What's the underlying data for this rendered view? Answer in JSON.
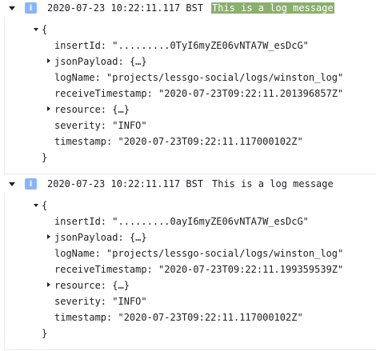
{
  "entries": [
    {
      "timestamp": "2020-07-23 10:22:11.117 BST",
      "message": "This is a log message",
      "severity_icon": "info-icon",
      "badge_letter": "i",
      "open_brace": "{",
      "close_brace": "}",
      "insertId_key": "insertId:",
      "insertId_val": "\".........0TyI6myZE06vNTA7W_esDcG\"",
      "jsonPayload_key": "jsonPayload:",
      "jsonPayload_val": "{…}",
      "logName_key": "logName:",
      "logName_val": "\"projects/lessgo-social/logs/winston_log\"",
      "receiveTimestamp_key": "receiveTimestamp:",
      "receiveTimestamp_val": "\"2020-07-23T09:22:11.201396857Z\"",
      "resource_key": "resource:",
      "resource_val": "{…}",
      "severity_key": "severity:",
      "severity_val": "\"INFO\"",
      "timestamp_key": "timestamp:",
      "timestamp_val": "\"2020-07-23T09:22:11.117000102Z\""
    },
    {
      "timestamp": "2020-07-23 10:22:11.117 BST",
      "message": "This is a log message",
      "severity_icon": "info-icon",
      "badge_letter": "i",
      "open_brace": "{",
      "close_brace": "}",
      "insertId_key": "insertId:",
      "insertId_val": "\".........0ayI6myZE06vNTA7W_esDcG\"",
      "jsonPayload_key": "jsonPayload:",
      "jsonPayload_val": "{…}",
      "logName_key": "logName:",
      "logName_val": "\"projects/lessgo-social/logs/winston_log\"",
      "receiveTimestamp_key": "receiveTimestamp:",
      "receiveTimestamp_val": "\"2020-07-23T09:22:11.199359539Z\"",
      "resource_key": "resource:",
      "resource_val": "{…}",
      "severity_key": "severity:",
      "severity_val": "\"INFO\"",
      "timestamp_key": "timestamp:",
      "timestamp_val": "\"2020-07-23T09:22:11.117000102Z\""
    }
  ],
  "colors": {
    "badge": "#8ab4f8",
    "highlight": "#8ab06c",
    "divider": "#e8eaed"
  }
}
